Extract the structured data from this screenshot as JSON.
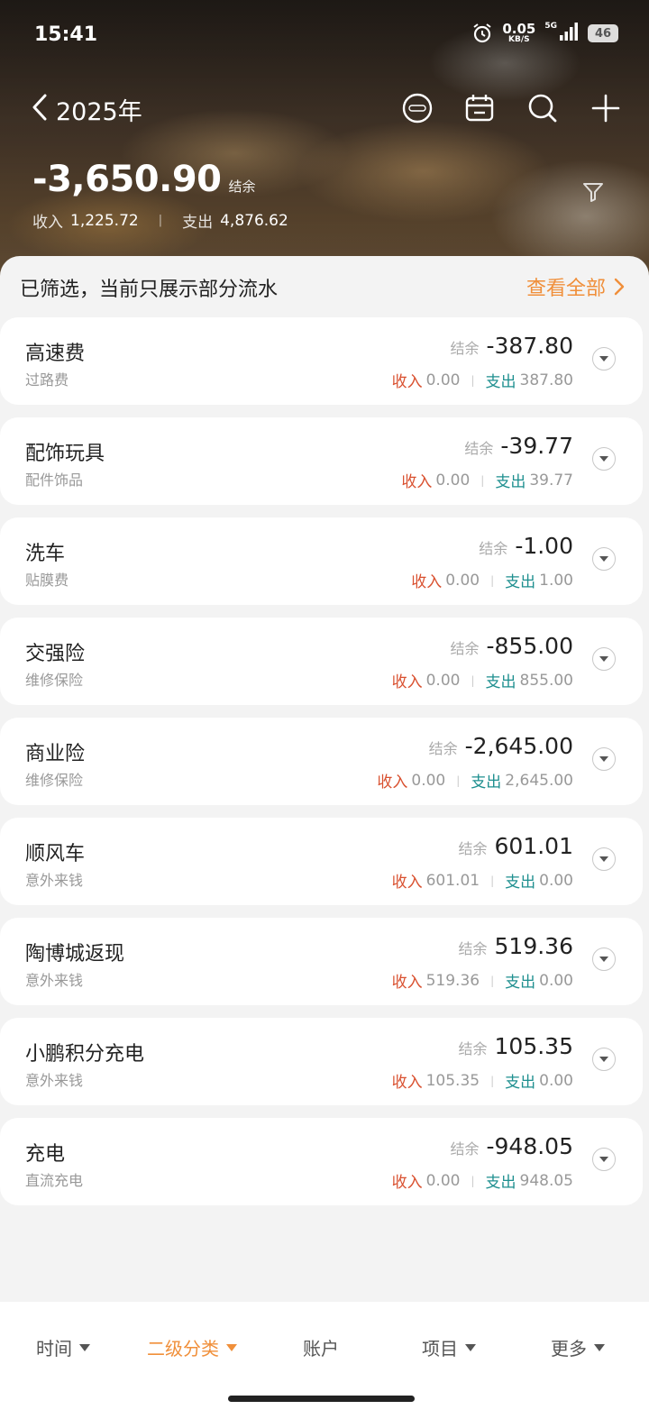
{
  "status_bar": {
    "time": "15:41",
    "net_speed_value": "0.05",
    "net_speed_unit": "KB/S",
    "network": "5G",
    "battery": "46"
  },
  "header": {
    "title": "2025年",
    "balance": "-3,650.90",
    "balance_label": "结余",
    "income_label": "收入",
    "income_value": "1,225.72",
    "expense_label": "支出",
    "expense_value": "4,876.62"
  },
  "filter": {
    "notice": "已筛选，当前只展示部分流水",
    "view_all": "查看全部"
  },
  "items": [
    {
      "title": "高速费",
      "sub": "过路费",
      "balance_label": "结余",
      "balance": "-387.80",
      "income_label": "收入",
      "income": "0.00",
      "expense_label": "支出",
      "expense": "387.80"
    },
    {
      "title": "配饰玩具",
      "sub": "配件饰品",
      "balance_label": "结余",
      "balance": "-39.77",
      "income_label": "收入",
      "income": "0.00",
      "expense_label": "支出",
      "expense": "39.77"
    },
    {
      "title": "洗车",
      "sub": "贴膜费",
      "balance_label": "结余",
      "balance": "-1.00",
      "income_label": "收入",
      "income": "0.00",
      "expense_label": "支出",
      "expense": "1.00"
    },
    {
      "title": "交强险",
      "sub": "维修保险",
      "balance_label": "结余",
      "balance": "-855.00",
      "income_label": "收入",
      "income": "0.00",
      "expense_label": "支出",
      "expense": "855.00"
    },
    {
      "title": "商业险",
      "sub": "维修保险",
      "balance_label": "结余",
      "balance": "-2,645.00",
      "income_label": "收入",
      "income": "0.00",
      "expense_label": "支出",
      "expense": "2,645.00"
    },
    {
      "title": "顺风车",
      "sub": "意外来钱",
      "balance_label": "结余",
      "balance": "601.01",
      "income_label": "收入",
      "income": "601.01",
      "expense_label": "支出",
      "expense": "0.00"
    },
    {
      "title": "陶博城返现",
      "sub": "意外来钱",
      "balance_label": "结余",
      "balance": "519.36",
      "income_label": "收入",
      "income": "519.36",
      "expense_label": "支出",
      "expense": "0.00"
    },
    {
      "title": "小鹏积分充电",
      "sub": "意外来钱",
      "balance_label": "结余",
      "balance": "105.35",
      "income_label": "收入",
      "income": "105.35",
      "expense_label": "支出",
      "expense": "0.00"
    },
    {
      "title": "充电",
      "sub": "直流充电",
      "balance_label": "结余",
      "balance": "-948.05",
      "income_label": "收入",
      "income": "0.00",
      "expense_label": "支出",
      "expense": "948.05"
    }
  ],
  "tabs": [
    {
      "label": "时间",
      "active": false
    },
    {
      "label": "二级分类",
      "active": true
    },
    {
      "label": "账户",
      "active": false,
      "no_caret": true
    },
    {
      "label": "项目",
      "active": false
    },
    {
      "label": "更多",
      "active": false
    }
  ],
  "colors": {
    "accent": "#f08f3a",
    "income": "#d9502f",
    "expense": "#1e8f8f"
  },
  "icons": [
    "alarm-icon",
    "signal-icon",
    "back-icon",
    "theme-icon",
    "calendar-icon",
    "search-icon",
    "add-icon",
    "filter-icon",
    "chevron-right-icon",
    "expand-icon"
  ]
}
